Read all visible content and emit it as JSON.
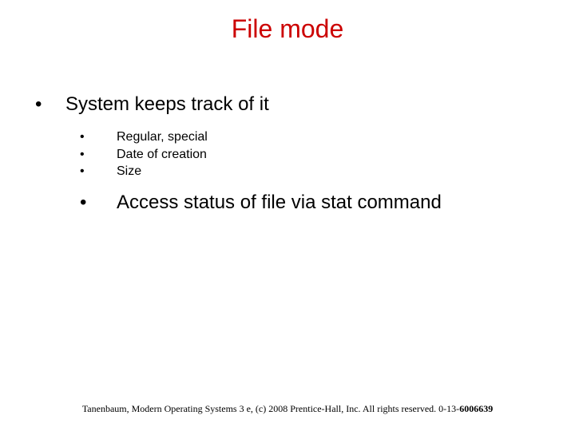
{
  "title": "File mode",
  "bullets": {
    "lvl1": {
      "mark": "•",
      "text": "System keeps track of it"
    },
    "subA": {
      "mark": "•",
      "text": "Regular, special"
    },
    "subB": {
      "mark": "•",
      "text": "Date of creation"
    },
    "subC": {
      "mark": "•",
      "text": "Size"
    },
    "subD": {
      "mark": "•",
      "text": "Access status of file via stat command"
    }
  },
  "footer": {
    "text_main": "Tanenbaum, Modern Operating Systems 3 e, (c) 2008 Prentice-Hall, Inc. All rights reserved. 0-13-",
    "text_isbn_tail": "6006639"
  }
}
